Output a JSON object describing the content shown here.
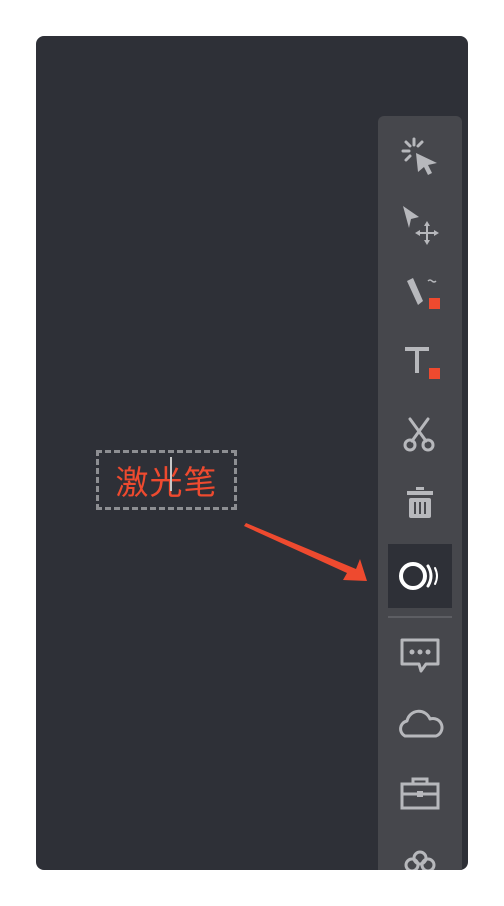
{
  "annotation": {
    "text": "激光笔"
  },
  "toolbar": {
    "tools": [
      {
        "name": "laser-select",
        "icon": "sparkle-cursor-icon"
      },
      {
        "name": "move",
        "icon": "move-cursor-icon"
      },
      {
        "name": "pen",
        "icon": "pen-icon",
        "badge_color": "#ee4a2f"
      },
      {
        "name": "text",
        "icon": "text-icon",
        "badge_color": "#ee4a2f"
      },
      {
        "name": "cut",
        "icon": "scissors-icon"
      },
      {
        "name": "delete",
        "icon": "trash-icon"
      },
      {
        "name": "laser-pointer",
        "icon": "laser-pointer-icon",
        "active": true
      },
      {
        "name": "comment",
        "icon": "chat-bubble-icon"
      },
      {
        "name": "cloud",
        "icon": "cloud-icon"
      },
      {
        "name": "toolbox",
        "icon": "toolbox-icon"
      },
      {
        "name": "more",
        "icon": "flower-icon"
      }
    ]
  },
  "colors": {
    "background": "#2e3037",
    "toolbar": "#46474c",
    "icon": "#b7b8bc",
    "accent": "#ee4a2f",
    "dash": "#8d8e92"
  }
}
